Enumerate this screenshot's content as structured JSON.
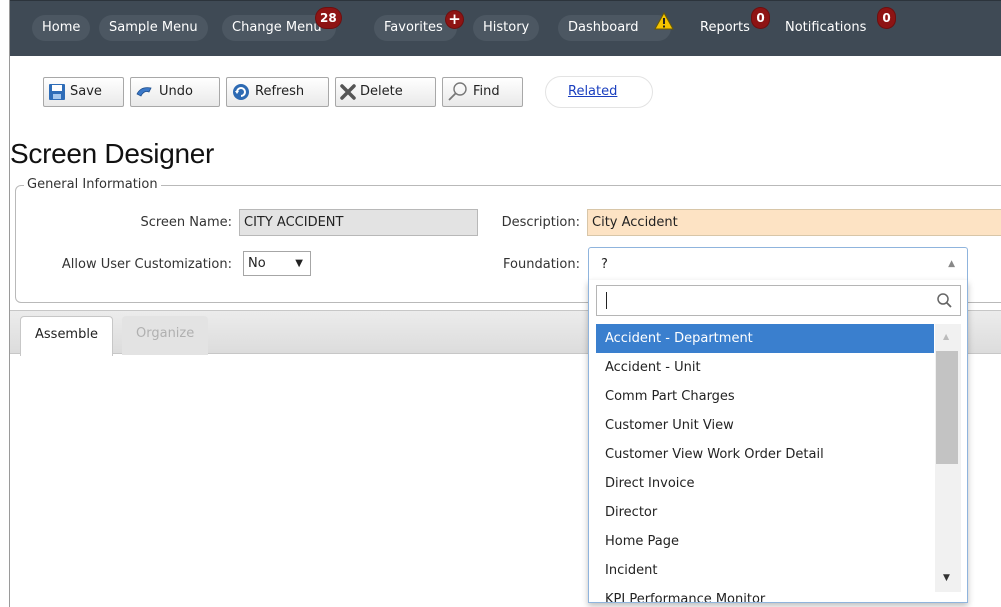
{
  "nav": {
    "home": "Home",
    "sample_menu": "Sample Menu",
    "change_menu": "Change Menu",
    "change_menu_badge": "28",
    "favorites": "Favorites",
    "favorites_badge": "+",
    "history": "History",
    "dashboard": "Dashboard",
    "reports": "Reports",
    "reports_badge": "0",
    "notifications": "Notifications",
    "notifications_badge": "0"
  },
  "toolbar": {
    "save": "Save",
    "undo": "Undo",
    "refresh": "Refresh",
    "delete": "Delete",
    "find": "Find",
    "related": "Related"
  },
  "page": {
    "title": "Screen Designer"
  },
  "general": {
    "legend": "General Information",
    "screen_name_label": "Screen Name:",
    "screen_name_value": "CITY ACCIDENT",
    "description_label": "Description:",
    "description_value": "City Accident",
    "allow_label": "Allow User Customization:",
    "allow_value": "No",
    "foundation_label": "Foundation:",
    "foundation_value": "?"
  },
  "tabs": {
    "assemble": "Assemble",
    "organize": "Organize"
  },
  "dropdown": {
    "search_value": "",
    "items": [
      "Accident - Department",
      "Accident - Unit",
      "Comm Part Charges",
      "Customer Unit View",
      "Customer View Work Order Detail",
      "Direct Invoice",
      "Director",
      "Home Page",
      "Incident",
      "KPI Performance Monitor"
    ],
    "selected_index": 0
  },
  "colors": {
    "nav_bg": "#3f4a55",
    "badge": "#8e1414",
    "selection": "#3a7fce",
    "required_field": "#fde3c4",
    "link": "#1a3fbf"
  }
}
